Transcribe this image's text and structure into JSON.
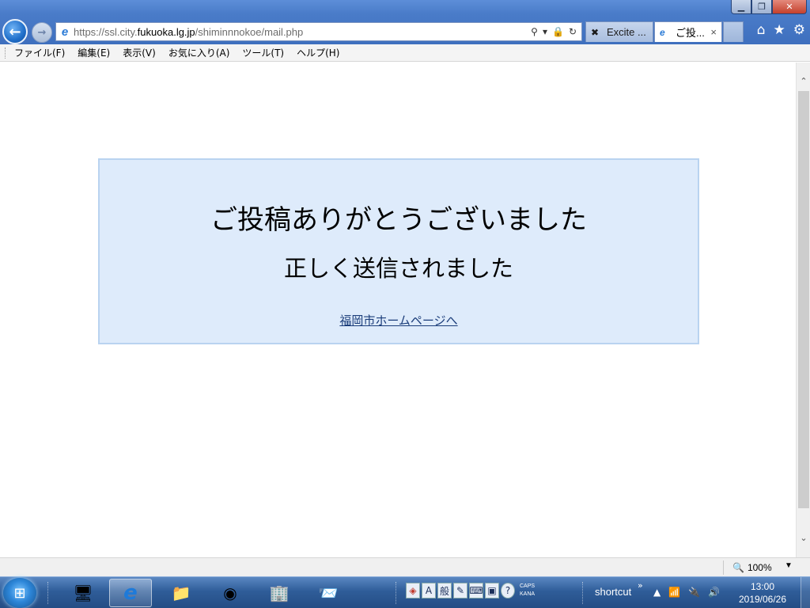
{
  "browser": {
    "url_prefix": "https://ssl.city.",
    "url_domain": "fukuoka.lg.jp",
    "url_path": "/shiminnnokoe/mail.php",
    "tabs": [
      {
        "label": "Excite ...",
        "active": false
      },
      {
        "label": "ご投...",
        "active": true
      }
    ],
    "tab_close": "×"
  },
  "menu": {
    "items": [
      "ファイル(F)",
      "編集(E)",
      "表示(V)",
      "お気に入り(A)",
      "ツール(T)",
      "ヘルプ(H)"
    ]
  },
  "page": {
    "title": "ご投稿ありがとうございました",
    "subtitle": "正しく送信されました",
    "link": "福岡市ホームページへ"
  },
  "status": {
    "zoom": "100%"
  },
  "taskbar": {
    "shortcut_label": "shortcut",
    "caps": "CAPS",
    "kana": "KANA",
    "ime_mode": "A",
    "ime_dict": "般",
    "time": "13:00",
    "date": "2019/06/26"
  },
  "colors": {
    "message_bg": "#deebfb",
    "message_border": "#b9d3f0",
    "link": "#1b3d7a",
    "taskbar": "#2f5d99"
  }
}
